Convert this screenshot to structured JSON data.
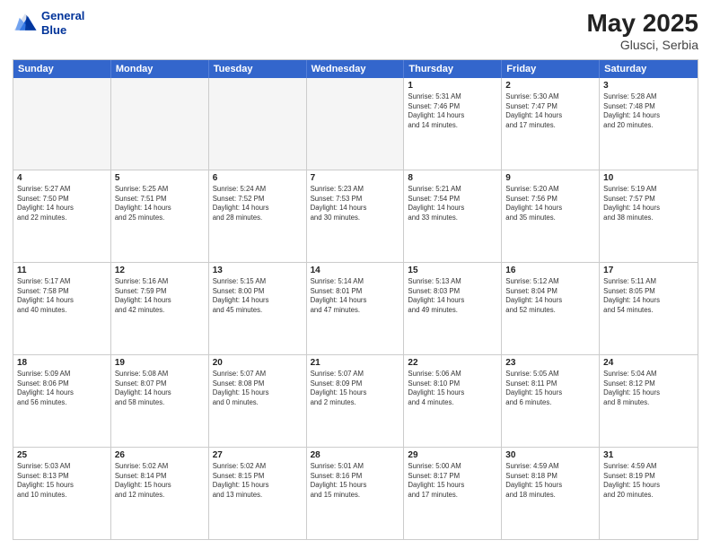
{
  "header": {
    "logo_line1": "General",
    "logo_line2": "Blue",
    "month_year": "May 2025",
    "location": "Glusci, Serbia"
  },
  "days_of_week": [
    "Sunday",
    "Monday",
    "Tuesday",
    "Wednesday",
    "Thursday",
    "Friday",
    "Saturday"
  ],
  "weeks": [
    [
      {
        "day": "",
        "empty": true,
        "detail": ""
      },
      {
        "day": "",
        "empty": true,
        "detail": ""
      },
      {
        "day": "",
        "empty": true,
        "detail": ""
      },
      {
        "day": "",
        "empty": true,
        "detail": ""
      },
      {
        "day": "1",
        "detail": "Sunrise: 5:31 AM\nSunset: 7:46 PM\nDaylight: 14 hours\nand 14 minutes."
      },
      {
        "day": "2",
        "detail": "Sunrise: 5:30 AM\nSunset: 7:47 PM\nDaylight: 14 hours\nand 17 minutes."
      },
      {
        "day": "3",
        "detail": "Sunrise: 5:28 AM\nSunset: 7:48 PM\nDaylight: 14 hours\nand 20 minutes."
      }
    ],
    [
      {
        "day": "4",
        "detail": "Sunrise: 5:27 AM\nSunset: 7:50 PM\nDaylight: 14 hours\nand 22 minutes."
      },
      {
        "day": "5",
        "detail": "Sunrise: 5:25 AM\nSunset: 7:51 PM\nDaylight: 14 hours\nand 25 minutes."
      },
      {
        "day": "6",
        "detail": "Sunrise: 5:24 AM\nSunset: 7:52 PM\nDaylight: 14 hours\nand 28 minutes."
      },
      {
        "day": "7",
        "detail": "Sunrise: 5:23 AM\nSunset: 7:53 PM\nDaylight: 14 hours\nand 30 minutes."
      },
      {
        "day": "8",
        "detail": "Sunrise: 5:21 AM\nSunset: 7:54 PM\nDaylight: 14 hours\nand 33 minutes."
      },
      {
        "day": "9",
        "detail": "Sunrise: 5:20 AM\nSunset: 7:56 PM\nDaylight: 14 hours\nand 35 minutes."
      },
      {
        "day": "10",
        "detail": "Sunrise: 5:19 AM\nSunset: 7:57 PM\nDaylight: 14 hours\nand 38 minutes."
      }
    ],
    [
      {
        "day": "11",
        "detail": "Sunrise: 5:17 AM\nSunset: 7:58 PM\nDaylight: 14 hours\nand 40 minutes."
      },
      {
        "day": "12",
        "detail": "Sunrise: 5:16 AM\nSunset: 7:59 PM\nDaylight: 14 hours\nand 42 minutes."
      },
      {
        "day": "13",
        "detail": "Sunrise: 5:15 AM\nSunset: 8:00 PM\nDaylight: 14 hours\nand 45 minutes."
      },
      {
        "day": "14",
        "detail": "Sunrise: 5:14 AM\nSunset: 8:01 PM\nDaylight: 14 hours\nand 47 minutes."
      },
      {
        "day": "15",
        "detail": "Sunrise: 5:13 AM\nSunset: 8:03 PM\nDaylight: 14 hours\nand 49 minutes."
      },
      {
        "day": "16",
        "detail": "Sunrise: 5:12 AM\nSunset: 8:04 PM\nDaylight: 14 hours\nand 52 minutes."
      },
      {
        "day": "17",
        "detail": "Sunrise: 5:11 AM\nSunset: 8:05 PM\nDaylight: 14 hours\nand 54 minutes."
      }
    ],
    [
      {
        "day": "18",
        "detail": "Sunrise: 5:09 AM\nSunset: 8:06 PM\nDaylight: 14 hours\nand 56 minutes."
      },
      {
        "day": "19",
        "detail": "Sunrise: 5:08 AM\nSunset: 8:07 PM\nDaylight: 14 hours\nand 58 minutes."
      },
      {
        "day": "20",
        "detail": "Sunrise: 5:07 AM\nSunset: 8:08 PM\nDaylight: 15 hours\nand 0 minutes."
      },
      {
        "day": "21",
        "detail": "Sunrise: 5:07 AM\nSunset: 8:09 PM\nDaylight: 15 hours\nand 2 minutes."
      },
      {
        "day": "22",
        "detail": "Sunrise: 5:06 AM\nSunset: 8:10 PM\nDaylight: 15 hours\nand 4 minutes."
      },
      {
        "day": "23",
        "detail": "Sunrise: 5:05 AM\nSunset: 8:11 PM\nDaylight: 15 hours\nand 6 minutes."
      },
      {
        "day": "24",
        "detail": "Sunrise: 5:04 AM\nSunset: 8:12 PM\nDaylight: 15 hours\nand 8 minutes."
      }
    ],
    [
      {
        "day": "25",
        "detail": "Sunrise: 5:03 AM\nSunset: 8:13 PM\nDaylight: 15 hours\nand 10 minutes."
      },
      {
        "day": "26",
        "detail": "Sunrise: 5:02 AM\nSunset: 8:14 PM\nDaylight: 15 hours\nand 12 minutes."
      },
      {
        "day": "27",
        "detail": "Sunrise: 5:02 AM\nSunset: 8:15 PM\nDaylight: 15 hours\nand 13 minutes."
      },
      {
        "day": "28",
        "detail": "Sunrise: 5:01 AM\nSunset: 8:16 PM\nDaylight: 15 hours\nand 15 minutes."
      },
      {
        "day": "29",
        "detail": "Sunrise: 5:00 AM\nSunset: 8:17 PM\nDaylight: 15 hours\nand 17 minutes."
      },
      {
        "day": "30",
        "detail": "Sunrise: 4:59 AM\nSunset: 8:18 PM\nDaylight: 15 hours\nand 18 minutes."
      },
      {
        "day": "31",
        "detail": "Sunrise: 4:59 AM\nSunset: 8:19 PM\nDaylight: 15 hours\nand 20 minutes."
      }
    ]
  ]
}
